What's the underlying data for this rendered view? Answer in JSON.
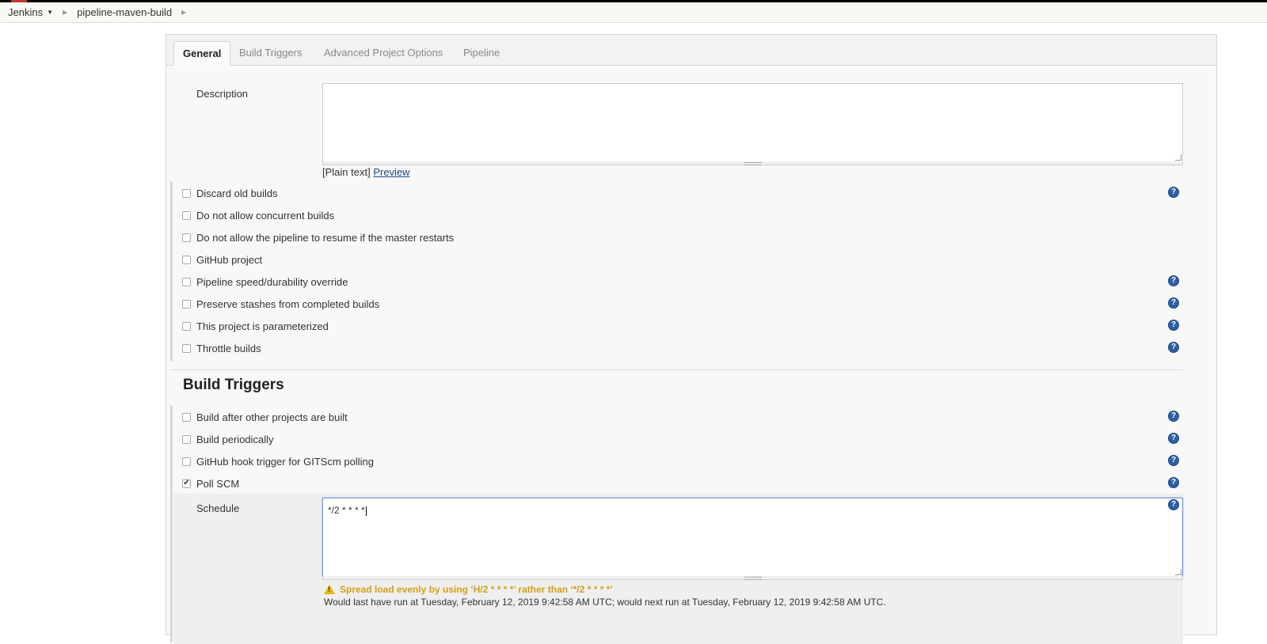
{
  "breadcrumb": {
    "home": "Jenkins",
    "job": "pipeline-maven-build"
  },
  "tabs": [
    {
      "label": "General",
      "active": true
    },
    {
      "label": "Build Triggers",
      "active": false
    },
    {
      "label": "Advanced Project Options",
      "active": false
    },
    {
      "label": "Pipeline",
      "active": false
    }
  ],
  "description": {
    "label": "Description",
    "value": "",
    "format_text": "[Plain text]",
    "preview_link": "Preview"
  },
  "general_options": [
    {
      "label": "Discard old builds",
      "checked": false,
      "help": true
    },
    {
      "label": "Do not allow concurrent builds",
      "checked": false,
      "help": false
    },
    {
      "label": "Do not allow the pipeline to resume if the master restarts",
      "checked": false,
      "help": false
    },
    {
      "label": "GitHub project",
      "checked": false,
      "help": false
    },
    {
      "label": "Pipeline speed/durability override",
      "checked": false,
      "help": true
    },
    {
      "label": "Preserve stashes from completed builds",
      "checked": false,
      "help": true
    },
    {
      "label": "This project is parameterized",
      "checked": false,
      "help": true
    },
    {
      "label": "Throttle builds",
      "checked": false,
      "help": true
    }
  ],
  "build_triggers": {
    "heading": "Build Triggers",
    "options": [
      {
        "label": "Build after other projects are built",
        "checked": false,
        "help": true
      },
      {
        "label": "Build periodically",
        "checked": false,
        "help": true
      },
      {
        "label": "GitHub hook trigger for GITScm polling",
        "checked": false,
        "help": true
      },
      {
        "label": "Poll SCM",
        "checked": true,
        "help": true
      }
    ],
    "schedule": {
      "label": "Schedule",
      "value": "*/2 * * * *",
      "warning": "Spread load evenly by using ‘H/2 * * * *’ rather than ‘*/2 * * * *’",
      "info": "Would last have run at Tuesday, February 12, 2019 9:42:58 AM UTC; would next run at Tuesday, February 12, 2019 9:42:58 AM UTC."
    }
  },
  "icons": {
    "help": "help-icon",
    "warning": "warning-icon",
    "checkmark": "✔"
  },
  "colors": {
    "help_blue": "#2d5fa8",
    "warning": "#d4a017",
    "focus_border": "#6f8fd6"
  }
}
